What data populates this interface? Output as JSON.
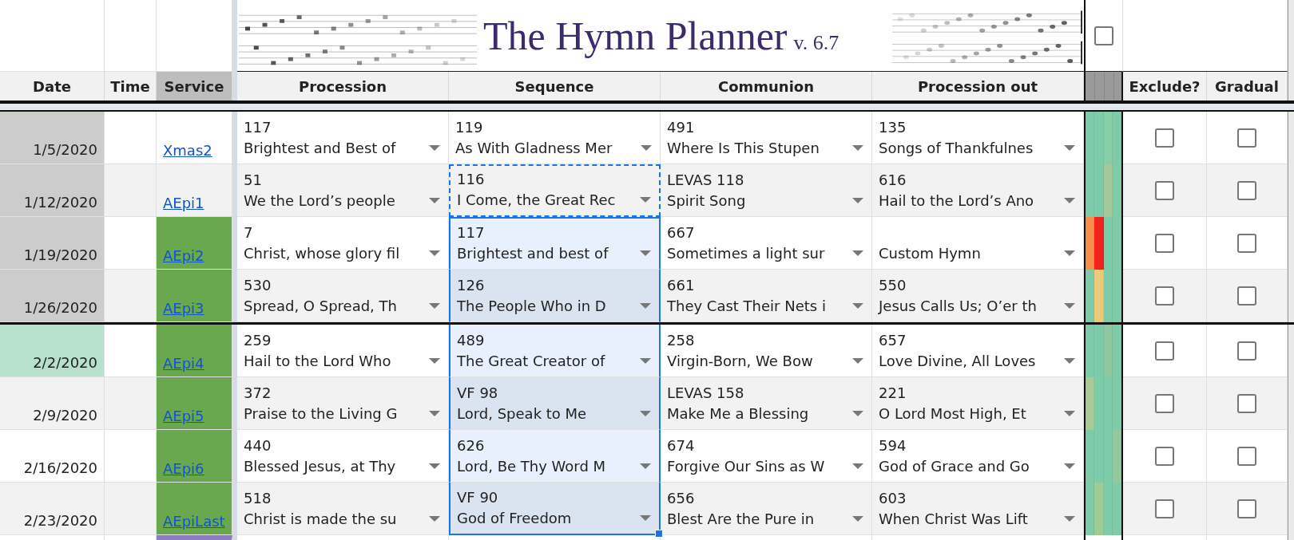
{
  "banner": {
    "title": "The Hymn Planner",
    "version": "v. 6.7",
    "checked": false
  },
  "columns": [
    "Date",
    "Time",
    "Service",
    "Procession",
    "Sequence",
    "Communion",
    "Procession out",
    "Exclude?",
    "Gradual"
  ],
  "rows": [
    {
      "date": "1/5/2020",
      "past": true,
      "current": false,
      "service": "Xmas2",
      "service_highlighted": false,
      "hymns": [
        {
          "number": "117",
          "title": "Brightest and Best of",
          "selected": false,
          "copied": false
        },
        {
          "number": "119",
          "title": "As With Gladness Mer",
          "selected": false,
          "copied": false
        },
        {
          "number": "491",
          "title": "Where Is This Stupen",
          "selected": false,
          "copied": false
        },
        {
          "number": "135",
          "title": "Songs of Thankfulnes",
          "selected": false,
          "copied": false
        }
      ],
      "heat": [
        {
          "color": "#7ecba9"
        },
        {
          "color": "#7ecba9"
        },
        {
          "color": "#86cda8"
        },
        {
          "color": "#7ecba9"
        }
      ],
      "exclude": false,
      "gradual": false
    },
    {
      "date": "1/12/2020",
      "past": true,
      "current": false,
      "service": "AEpi1",
      "service_highlighted": false,
      "hymns": [
        {
          "number": "51",
          "title": "We the Lord’s people",
          "selected": false,
          "copied": false
        },
        {
          "number": "116",
          "title": "I Come, the Great Rec",
          "selected": false,
          "copied": true
        },
        {
          "number": "LEVAS 118",
          "title": "Spirit Song",
          "selected": false,
          "copied": false
        },
        {
          "number": "616",
          "title": "Hail to the Lord’s Ano",
          "selected": false,
          "copied": false
        }
      ],
      "heat": [
        {
          "color": "#7ecba9"
        },
        {
          "color": "#7ecba9"
        },
        {
          "color": "#a3c99a"
        },
        {
          "color": "#7ecba9"
        }
      ],
      "exclude": false,
      "gradual": false
    },
    {
      "date": "1/19/2020",
      "past": true,
      "current": false,
      "service": "AEpi2",
      "service_highlighted": true,
      "hymns": [
        {
          "number": "7",
          "title": "Christ, whose glory fil",
          "selected": false,
          "copied": false
        },
        {
          "number": "117",
          "title": "Brightest and best of",
          "selected": true,
          "copied": false
        },
        {
          "number": "667",
          "title": "Sometimes a light sur",
          "selected": false,
          "copied": false
        },
        {
          "title": "Custom Hymn",
          "selected": false,
          "copied": false
        }
      ],
      "heat": [
        {
          "color": "#f98e4a"
        },
        {
          "color": "#f2231f"
        },
        {
          "color": "#7ecba9"
        },
        {
          "color": "#7ecba9"
        }
      ],
      "exclude": false,
      "gradual": false
    },
    {
      "date": "1/26/2020",
      "past": true,
      "current": false,
      "service": "AEpi3",
      "service_highlighted": true,
      "hymns": [
        {
          "number": "530",
          "title": "Spread, O Spread, Th",
          "selected": false,
          "copied": false
        },
        {
          "number": "126",
          "title": "The People Who in D",
          "selected": true,
          "copied": false
        },
        {
          "number": "661",
          "title": "They Cast Their Nets i",
          "selected": false,
          "copied": false
        },
        {
          "number": "550",
          "title": "Jesus Calls Us; O’er th",
          "selected": false,
          "copied": false
        }
      ],
      "heat": [
        {
          "color": "#7ecba9"
        },
        {
          "color": "#eec97a"
        },
        {
          "color": "#7ecba9"
        },
        {
          "color": "#7ecba9"
        }
      ],
      "exclude": false,
      "gradual": false
    },
    {
      "date": "2/2/2020",
      "past": false,
      "current": true,
      "service": "AEpi4",
      "service_highlighted": true,
      "hymns": [
        {
          "number": "259",
          "title": "Hail to the Lord Who",
          "selected": false,
          "copied": false
        },
        {
          "number": "489",
          "title": "The Great Creator of",
          "selected": true,
          "copied": false
        },
        {
          "number": "258",
          "title": "Virgin-Born, We Bow",
          "selected": false,
          "copied": false
        },
        {
          "number": "657",
          "title": "Love Divine, All Loves",
          "selected": false,
          "copied": false
        }
      ],
      "heat": [
        {
          "color": "#7ecba9"
        },
        {
          "color": "#7ecba9"
        },
        {
          "color": "#8dc8a0"
        },
        {
          "color": "#7ecba9"
        }
      ],
      "exclude": false,
      "gradual": false
    },
    {
      "date": "2/9/2020",
      "past": false,
      "current": false,
      "service": "AEpi5",
      "service_highlighted": true,
      "hymns": [
        {
          "number": "372",
          "title": "Praise to the Living G",
          "selected": false,
          "copied": false
        },
        {
          "number": "VF 98",
          "title": "Lord, Speak to Me",
          "selected": true,
          "copied": false
        },
        {
          "number": "LEVAS 158",
          "title": "Make Me a Blessing",
          "selected": false,
          "copied": false
        },
        {
          "number": "221",
          "title": "O Lord Most High, Et",
          "selected": false,
          "copied": false
        }
      ],
      "heat": [
        {
          "color": "#a8ca94"
        },
        {
          "color": "#7ecba9"
        },
        {
          "color": "#7ecba9"
        },
        {
          "color": "#7ecba9"
        }
      ],
      "exclude": false,
      "gradual": false
    },
    {
      "date": "2/16/2020",
      "past": false,
      "current": false,
      "service": "AEpi6",
      "service_highlighted": true,
      "hymns": [
        {
          "number": "440",
          "title": "Blessed Jesus, at Thy",
          "selected": false,
          "copied": false
        },
        {
          "number": "626",
          "title": "Lord, Be Thy Word M",
          "selected": true,
          "copied": false
        },
        {
          "number": "674",
          "title": "Forgive Our Sins as W",
          "selected": false,
          "copied": false
        },
        {
          "number": "594",
          "title": "God of Grace and Go",
          "selected": false,
          "copied": false
        }
      ],
      "heat": [
        {
          "color": "#7ecba9"
        },
        {
          "color": "#7ecba9"
        },
        {
          "color": "#7ecba9"
        },
        {
          "color": "#93c99c"
        }
      ],
      "exclude": false,
      "gradual": false
    },
    {
      "date": "2/23/2020",
      "past": false,
      "current": false,
      "service": "AEpiLast",
      "service_highlighted": true,
      "hymns": [
        {
          "number": "518",
          "title": "Christ is made the su",
          "selected": false,
          "copied": false
        },
        {
          "number": "VF 90",
          "title": "God of Freedom",
          "selected": true,
          "copied": false
        },
        {
          "number": "656",
          "title": "Blest Are the Pure in",
          "selected": false,
          "copied": false
        },
        {
          "number": "603",
          "title": "When Christ Was Lift",
          "selected": false,
          "copied": false
        }
      ],
      "heat": [
        {
          "color": "#7ecba9"
        },
        {
          "color": "#9ecb98"
        },
        {
          "color": "#7ecba9"
        },
        {
          "color": "#7ecba9"
        }
      ],
      "exclude": false,
      "gradual": false
    }
  ]
}
